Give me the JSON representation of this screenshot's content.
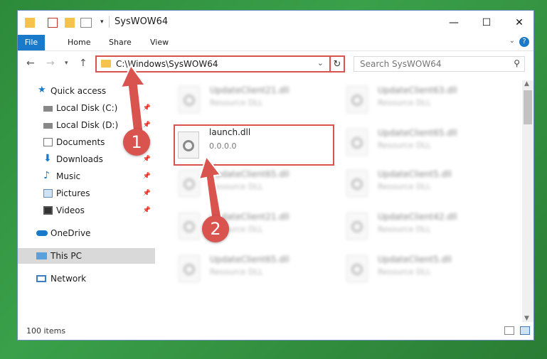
{
  "window": {
    "title": "SysWOW64",
    "buttons": {
      "minimize": "—",
      "maximize": "☐",
      "close": "✕"
    }
  },
  "ribbon": {
    "tabs": [
      {
        "label": "File"
      },
      {
        "label": "Home"
      },
      {
        "label": "Share"
      },
      {
        "label": "View"
      }
    ],
    "help": "?"
  },
  "address": {
    "path": "C:\\Windows\\SysWOW64",
    "search_placeholder": "Search SysWOW64"
  },
  "sidebar": {
    "items": [
      {
        "label": "Quick access",
        "icon": "star-icon"
      },
      {
        "label": "Local Disk (C:)",
        "icon": "drive-icon",
        "pinned": true
      },
      {
        "label": "Local Disk (D:)",
        "icon": "drive-icon",
        "pinned": true
      },
      {
        "label": "Documents",
        "icon": "documents-icon",
        "pinned": true
      },
      {
        "label": "Downloads",
        "icon": "download-icon",
        "pinned": true
      },
      {
        "label": "Music",
        "icon": "music-icon",
        "pinned": true
      },
      {
        "label": "Pictures",
        "icon": "pictures-icon",
        "pinned": true
      },
      {
        "label": "Videos",
        "icon": "videos-icon",
        "pinned": true
      },
      {
        "label": "OneDrive",
        "icon": "cloud-icon"
      },
      {
        "label": "This PC",
        "icon": "computer-icon",
        "selected": true
      },
      {
        "label": "Network",
        "icon": "network-icon"
      }
    ]
  },
  "files": {
    "col1": [
      {
        "name": "UpdateClient21.dll",
        "type": "Resource DLL"
      },
      {
        "name": "launch.dll",
        "type": "0.0.0.0"
      },
      {
        "name": "UpdateClient65.dll",
        "type": "Resource DLL"
      },
      {
        "name": "UpdateClient21.dll",
        "type": "Resource DLL"
      },
      {
        "name": "UpdateClient65.dll",
        "type": "Resource DLL"
      }
    ],
    "col2": [
      {
        "name": "UpdateClient63.dll",
        "type": "Resource DLL"
      },
      {
        "name": "UpdateClient65.dll",
        "type": "Resource DLL"
      },
      {
        "name": "UpdateClient5.dll",
        "type": "Resource DLL"
      },
      {
        "name": "UpdateClient42.dll",
        "type": "Resource DLL"
      },
      {
        "name": "UpdateClient5.dll",
        "type": "Resource DLL"
      }
    ]
  },
  "status": {
    "count": "100 items"
  },
  "callouts": [
    {
      "label": "1"
    },
    {
      "label": "2"
    }
  ],
  "colors": {
    "accent": "#1979ca",
    "callout": "#d9534f",
    "selected": "#d9d9d9"
  }
}
